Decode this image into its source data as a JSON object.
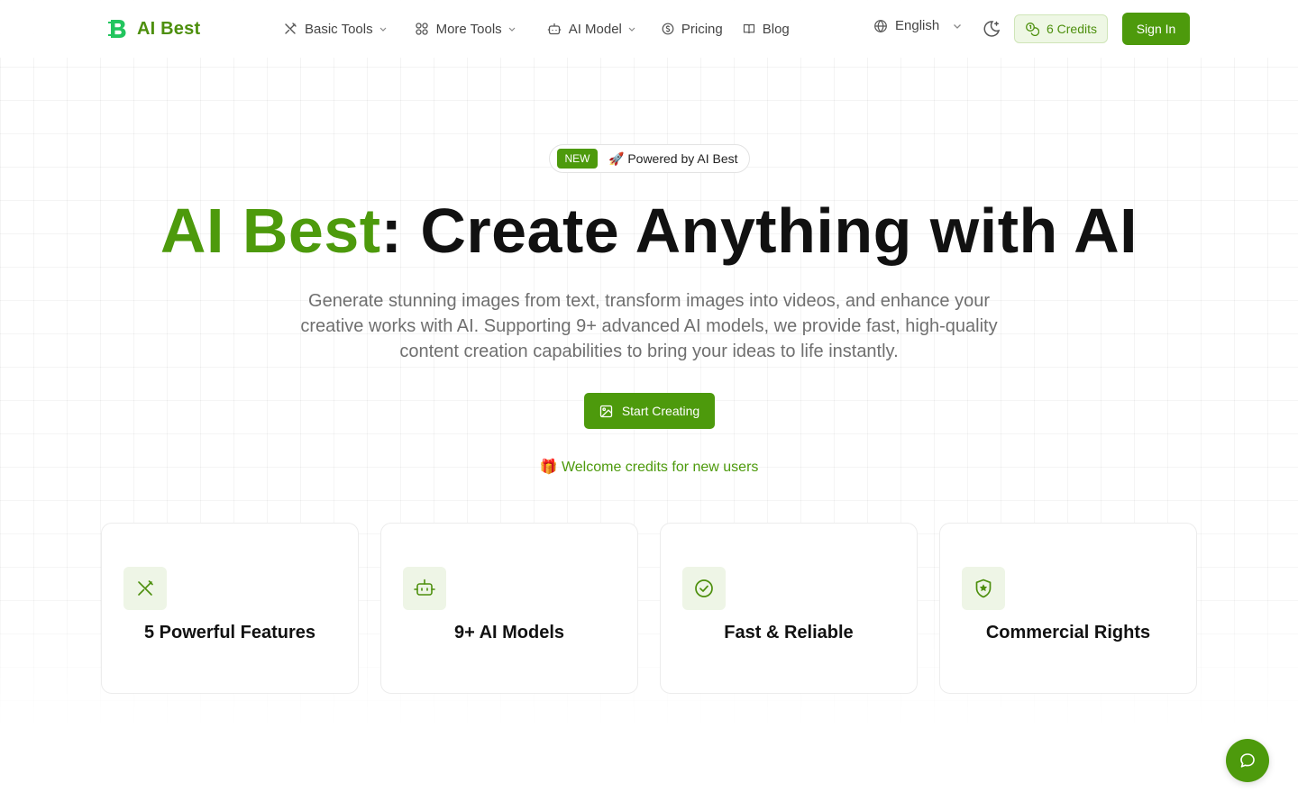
{
  "brand": {
    "name": "AI Best",
    "accent_color": "#4d9a0c"
  },
  "nav": {
    "items": [
      {
        "label": "Basic Tools",
        "icon": "tools-icon",
        "has_dropdown": true
      },
      {
        "label": "More Tools",
        "icon": "grid-icon",
        "has_dropdown": true
      },
      {
        "label": "AI Model",
        "icon": "robot-icon",
        "has_dropdown": true
      },
      {
        "label": "Pricing",
        "icon": "coin-icon",
        "has_dropdown": false
      },
      {
        "label": "Blog",
        "icon": "book-icon",
        "has_dropdown": false
      }
    ]
  },
  "header": {
    "language": "English",
    "credits_label": "6 Credits",
    "signin_label": "Sign In"
  },
  "hero": {
    "badge_new": "NEW",
    "badge_text": "🚀 Powered by AI Best",
    "title_accent": "AI Best",
    "title_rest": ": Create Anything with AI",
    "subtitle": "Generate stunning images from text, transform images into videos, and enhance your creative works with AI. Supporting 9+ advanced AI models, we provide fast, high-quality content creation capabilities to bring your ideas to life instantly.",
    "cta_label": "Start Creating",
    "welcome": "🎁 Welcome credits for new users"
  },
  "features": [
    {
      "title": "5 Powerful Features",
      "icon": "tools-icon"
    },
    {
      "title": "9+ AI Models",
      "icon": "robot-icon"
    },
    {
      "title": "Fast & Reliable",
      "icon": "check-circle-icon"
    },
    {
      "title": "Commercial Rights",
      "icon": "shield-star-icon"
    }
  ]
}
